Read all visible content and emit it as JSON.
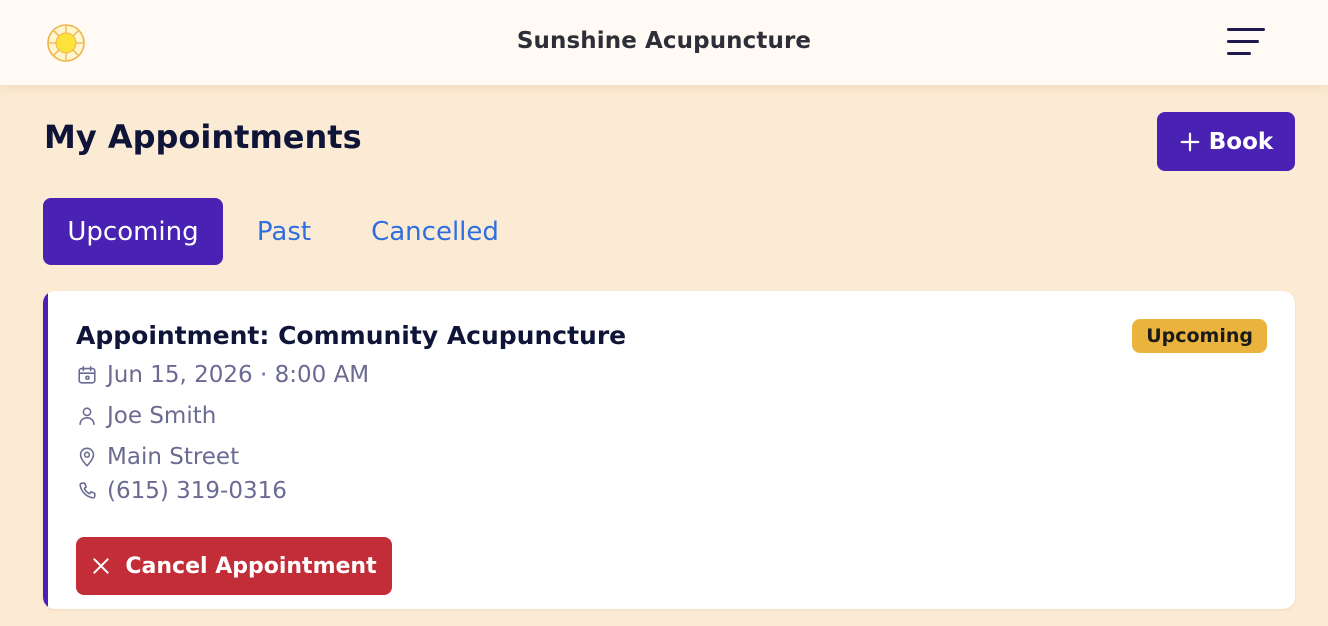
{
  "header": {
    "app_title": "Sunshine Acupuncture",
    "logo_icon": "sun-icon",
    "menu_icon": "hamburger-menu-icon"
  },
  "page": {
    "title": "My Appointments",
    "book_label": "Book",
    "book_icon": "plus-icon"
  },
  "tabs": [
    {
      "label": "Upcoming",
      "active": true
    },
    {
      "label": "Past",
      "active": false
    },
    {
      "label": "Cancelled",
      "active": false
    }
  ],
  "appointment": {
    "title": "Appointment: Community Acupuncture",
    "status": "Upcoming",
    "datetime": "Jun 15, 2026 · 8:00 AM",
    "practitioner": "Joe Smith",
    "location": "Main Street",
    "phone": "(615) 319-0316",
    "cancel_label": "Cancel Appointment",
    "icons": {
      "datetime": "calendar-icon",
      "practitioner": "person-icon",
      "location": "map-pin-icon",
      "phone": "phone-icon",
      "cancel": "close-icon"
    }
  },
  "colors": {
    "page_background": "#fcebd4",
    "header_background": "#fffaf3",
    "primary": "#4a22b3",
    "tab_link": "#2f6ee0",
    "status_badge": "#eab33e",
    "danger": "#c22d38",
    "detail_text": "#6b6a92",
    "heading_text": "#0e1538"
  }
}
